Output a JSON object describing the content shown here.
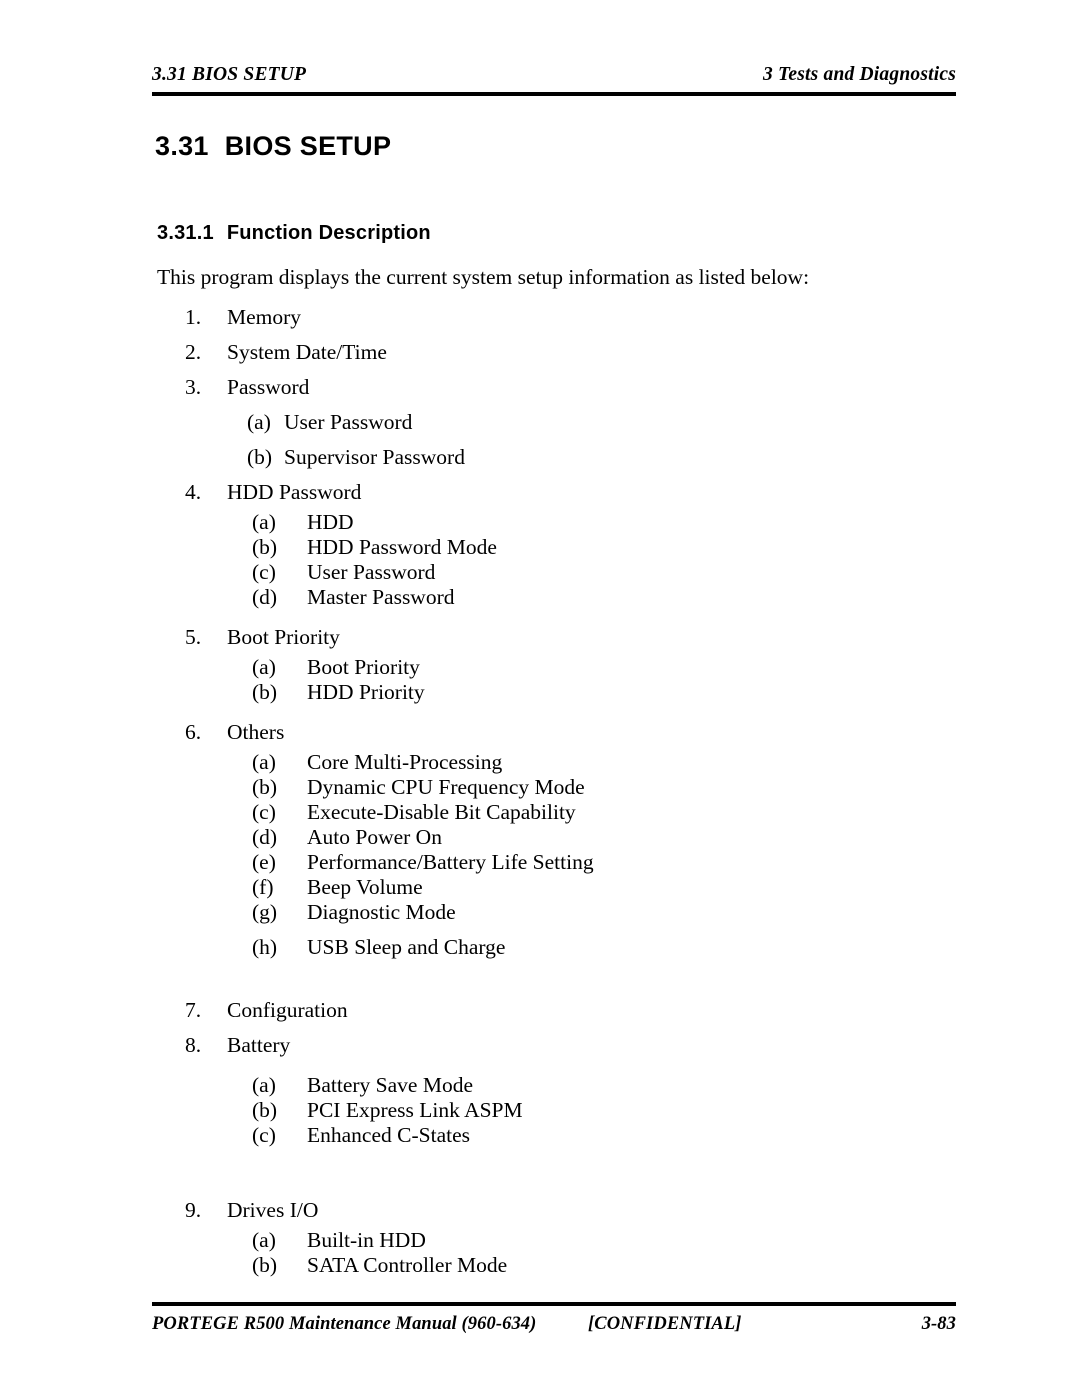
{
  "header": {
    "left": "3.31 BIOS SETUP",
    "right": "3 Tests and Diagnostics"
  },
  "headings": {
    "section_number": "3.31",
    "section_title": "BIOS SETUP",
    "subsection_number": "3.31.1",
    "subsection_title": "Function Description"
  },
  "body": {
    "intro": "This program displays the current system setup information as listed below:"
  },
  "list": [
    {
      "marker": "1.",
      "text": "Memory"
    },
    {
      "marker": "2.",
      "text": "System Date/Time"
    },
    {
      "marker": "3.",
      "text": "Password"
    },
    {
      "marker": "(a)",
      "text": "User Password"
    },
    {
      "marker": "(b)",
      "text": "Supervisor Password"
    },
    {
      "marker": "4.",
      "text": "HDD Password"
    },
    {
      "marker": "(a)",
      "text": "HDD"
    },
    {
      "marker": "(b)",
      "text": "HDD Password Mode"
    },
    {
      "marker": "(c)",
      "text": "User Password"
    },
    {
      "marker": "(d)",
      "text": "Master Password"
    },
    {
      "marker": "5.",
      "text": "Boot Priority"
    },
    {
      "marker": "(a)",
      "text": "Boot Priority"
    },
    {
      "marker": "(b)",
      "text": "HDD Priority"
    },
    {
      "marker": "6.",
      "text": "Others"
    },
    {
      "marker": "(a)",
      "text": "Core Multi-Processing"
    },
    {
      "marker": "(b)",
      "text": "Dynamic CPU Frequency Mode"
    },
    {
      "marker": "(c)",
      "text": "Execute-Disable Bit Capability"
    },
    {
      "marker": "(d)",
      "text": "Auto Power On"
    },
    {
      "marker": "(e)",
      "text": "Performance/Battery Life Setting"
    },
    {
      "marker": "(f)",
      "text": "Beep Volume"
    },
    {
      "marker": "(g)",
      "text": "Diagnostic Mode"
    },
    {
      "marker": "(h)",
      "text": "USB Sleep and Charge"
    },
    {
      "marker": "7.",
      "text": "Configuration"
    },
    {
      "marker": "8.",
      "text": "Battery"
    },
    {
      "marker": "(a)",
      "text": "Battery Save Mode"
    },
    {
      "marker": "(b)",
      "text": "PCI Express Link ASPM"
    },
    {
      "marker": "(c)",
      "text": "Enhanced C-States"
    },
    {
      "marker": "9.",
      "text": "Drives I/O"
    },
    {
      "marker": "(a)",
      "text": "Built-in HDD"
    },
    {
      "marker": "(b)",
      "text": "SATA Controller Mode"
    }
  ],
  "footer": {
    "left": "PORTEGE R500 Maintenance Manual (960-634)",
    "center": "[CONFIDENTIAL]",
    "page": "3-83"
  }
}
